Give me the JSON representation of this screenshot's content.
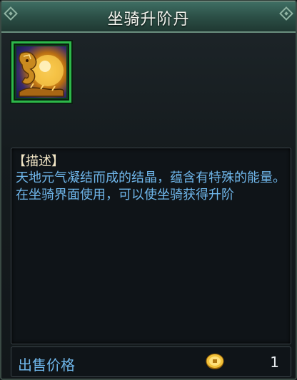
{
  "window": {
    "title": "坐骑升阶丹"
  },
  "item": {
    "icon": "mount-pill-icon",
    "rarity_color": "#2db84a"
  },
  "description": {
    "heading": "【描述】",
    "body": "天地元气凝结而成的结晶，蕴含有特殊的能量。在坐骑界面使用，可以使坐骑获得升阶"
  },
  "price": {
    "label": "出售价格",
    "currency_icon": "gold-coin-icon",
    "value": "1"
  }
}
